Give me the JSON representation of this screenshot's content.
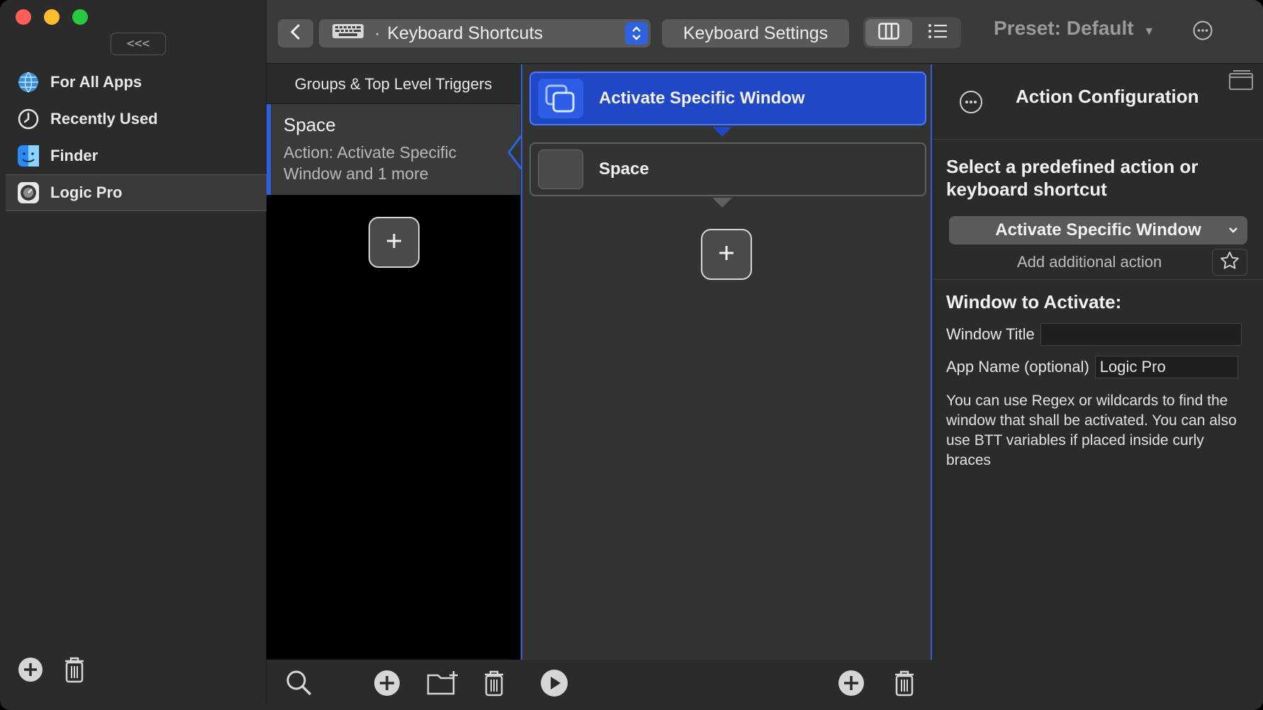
{
  "sidebar": {
    "collapse_label": "<<<",
    "items": [
      {
        "label": "For All Apps",
        "icon": "globe-icon"
      },
      {
        "label": "Recently Used",
        "icon": "clock-icon"
      },
      {
        "label": "Finder",
        "icon": "finder-icon"
      },
      {
        "label": "Logic Pro",
        "icon": "logic-pro-icon",
        "selected": true
      }
    ]
  },
  "toolbar": {
    "trigger_type": "Keyboard Shortcuts",
    "settings_label": "Keyboard Settings",
    "preset_label": "Preset: Default"
  },
  "triggers": {
    "header": "Groups & Top Level Triggers",
    "items": [
      {
        "name": "Space",
        "desc": "Action: Activate Specific Window and 1 more"
      }
    ]
  },
  "actions": {
    "items": [
      {
        "label": "Activate Specific Window",
        "selected": true
      },
      {
        "label": "Space",
        "selected": false
      }
    ]
  },
  "config": {
    "title": "Action Configuration",
    "subtitle": "Select a predefined action or keyboard shortcut",
    "selected_action": "Activate Specific Window",
    "add_additional": "Add additional action",
    "section": "Window to Activate:",
    "window_title_label": "Window Title",
    "window_title_value": "",
    "app_name_label": "App Name (optional)",
    "app_name_value": "Logic Pro",
    "help": "You can use Regex or wildcards to find the window that shall be activated. You can also use BTT variables if placed inside curly braces"
  },
  "colors": {
    "accent": "#2d63e0",
    "selected_card": "#1f47c6"
  }
}
